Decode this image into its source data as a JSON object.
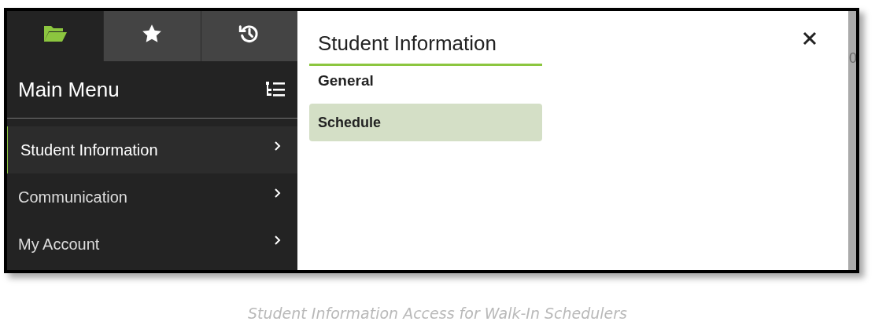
{
  "tabs": [
    {
      "kind": "folder",
      "selected": true
    },
    {
      "kind": "star",
      "selected": false
    },
    {
      "kind": "history",
      "selected": false
    }
  ],
  "sidebar": {
    "title": "Main Menu",
    "items": [
      {
        "label": "Student Information",
        "selected": true
      },
      {
        "label": "Communication",
        "selected": false
      },
      {
        "label": "My Account",
        "selected": false
      }
    ]
  },
  "panel": {
    "title": "Student Information",
    "sections": [
      {
        "heading": "General",
        "items": [
          {
            "label": "Schedule",
            "selected": true
          }
        ]
      }
    ]
  },
  "background_fragment": "0",
  "caption": "Student Information Access for Walk-In Schedulers"
}
